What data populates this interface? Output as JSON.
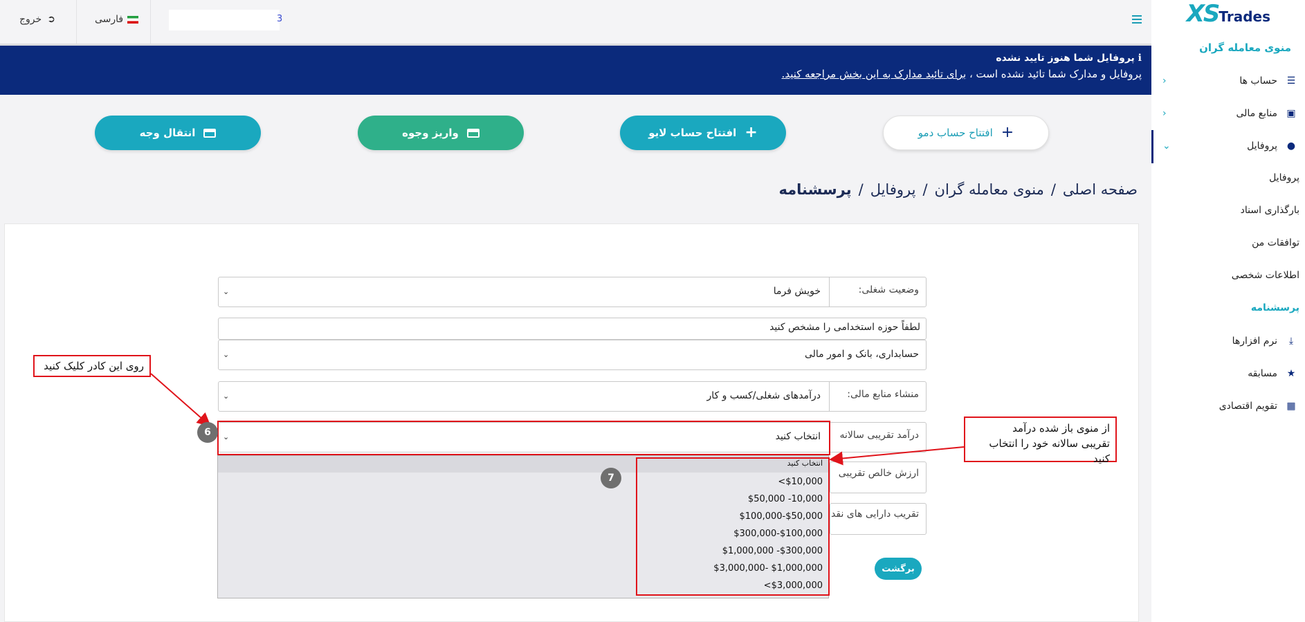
{
  "header": {
    "logout_label": "خروج",
    "logout_icon": "logout-icon",
    "language_label": "فارسی",
    "flag_icon": "iran-flag-icon",
    "user_tail": "3"
  },
  "alert": {
    "title": "پروفایل شما هنوز تایید نشده",
    "message": "پروفایل و مدارک شما تائید نشده است ، ",
    "link": "برای تائید مدارک به این بخش مراجعه کنید."
  },
  "actions": {
    "demo": "افتتاح حساب دمو",
    "live": "افتتاح حساب لایو",
    "deposit": "واریز وجوه",
    "transfer": "انتقال وجه"
  },
  "breadcrumb": [
    "صفحه اصلی",
    "منوی معامله گران",
    "پروفایل",
    "پرسشنامه"
  ],
  "form": {
    "employment_label": "وضعیت شغلی:",
    "employment_value": "خویش فرما",
    "field_prompt": "لطفاً حوزه استخدامی را مشخص کنید",
    "field_value": "حسابداری، بانک و امور مالی",
    "source_label": "منشاء منابع مالی:",
    "source_value": "درآمدهای شغلی/کسب و کار",
    "income_label": "درآمد تقریبی سالانه",
    "income_value": "انتخاب کنید",
    "networth_label": "ارزش خالص تقریبی",
    "cash_label": "تقریب دارایی های نقد",
    "back_label": "برگشت"
  },
  "dropdown": {
    "header": "انتخاب کنید",
    "options": [
      "<$10,000",
      "$50,000 -10,000",
      "$100,000-$50,000",
      "$300,000-$100,000",
      "$1,000,000 -$300,000",
      "$3,000,000- $1,000,000",
      "<$3,000,000"
    ]
  },
  "annotations": {
    "left_note": "روی این کادر کلیک کنید",
    "right_note_line1": "از منوی باز شده درآمد",
    "right_note_line2": "تقریبی سالانه خود را انتخاب کنید",
    "badge6": "6",
    "badge7": "7"
  },
  "sidebar": {
    "logo_xs": "XS",
    "logo_trades": "Trades",
    "menu_title": "منوی معامله گران",
    "items": [
      {
        "label": "حساب ها",
        "icon": "list-icon"
      },
      {
        "label": "منابع مالی",
        "icon": "wallet-icon"
      },
      {
        "label": "پروفایل",
        "icon": "user-icon"
      }
    ],
    "sub_items": [
      "پروفایل",
      "بارگذاری اسناد",
      "توافقات من",
      "اطلاعات شخصی",
      "پرسشنامه"
    ],
    "bottom_items": [
      {
        "label": "نرم افزارها",
        "icon": "download-icon"
      },
      {
        "label": "مسابقه",
        "icon": "trophy-icon"
      },
      {
        "label": "تقویم اقتصادی",
        "icon": "calendar-icon"
      }
    ]
  },
  "colors": {
    "accent": "#1aa8bf",
    "navy": "#0b2a7c",
    "green": "#2fb08a",
    "annotation_red": "#e0141b"
  }
}
